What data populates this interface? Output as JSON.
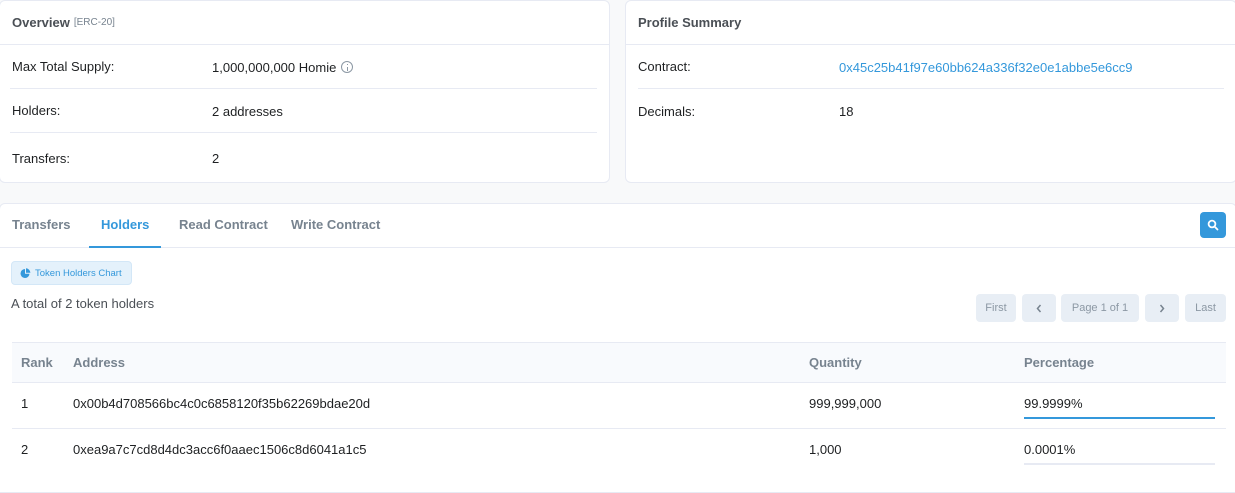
{
  "overview": {
    "title": "Overview",
    "badge": "[ERC-20]",
    "max_supply_label": "Max Total Supply:",
    "max_supply_value": "1,000,000,000 Homie",
    "holders_label": "Holders:",
    "holders_value": "2 addresses",
    "transfers_label": "Transfers:",
    "transfers_value": "2"
  },
  "profile": {
    "title": "Profile Summary",
    "contract_label": "Contract:",
    "contract_value": "0x45c25b41f97e60bb624a336f32e0e1abbe5e6cc9",
    "decimals_label": "Decimals:",
    "decimals_value": "18"
  },
  "tabs": [
    {
      "label": "Transfers",
      "active": false
    },
    {
      "label": "Holders",
      "active": true
    },
    {
      "label": "Read Contract",
      "active": false
    },
    {
      "label": "Write Contract",
      "active": false
    }
  ],
  "search_icon": "search-icon",
  "chart_button": {
    "label": "Token Holders Chart",
    "icon": "pie-chart-icon"
  },
  "total_text": "A total of 2 token holders",
  "pager": {
    "first": "First",
    "prev_icon": "chevron-left-icon",
    "page": "Page 1 of 1",
    "next_icon": "chevron-right-icon",
    "last": "Last"
  },
  "table": {
    "headers": [
      "Rank",
      "Address",
      "Quantity",
      "Percentage"
    ],
    "rows": [
      {
        "rank": "1",
        "address": "0x00b4d708566bc4c0c6858120f35b62269bdae20d",
        "quantity": "999,999,000",
        "percentage": "99.9999%",
        "fraction": 0.999999
      },
      {
        "rank": "2",
        "address": "0xea9a7c7cd8d4dc3acc6f0aaec1506c8d6041a1c5",
        "quantity": "1,000",
        "percentage": "0.0001%",
        "fraction": 1e-06
      }
    ]
  },
  "colors": {
    "accent": "#3498db",
    "text": "#1e2022",
    "muted": "#77838f",
    "border": "#e7eaf3"
  }
}
